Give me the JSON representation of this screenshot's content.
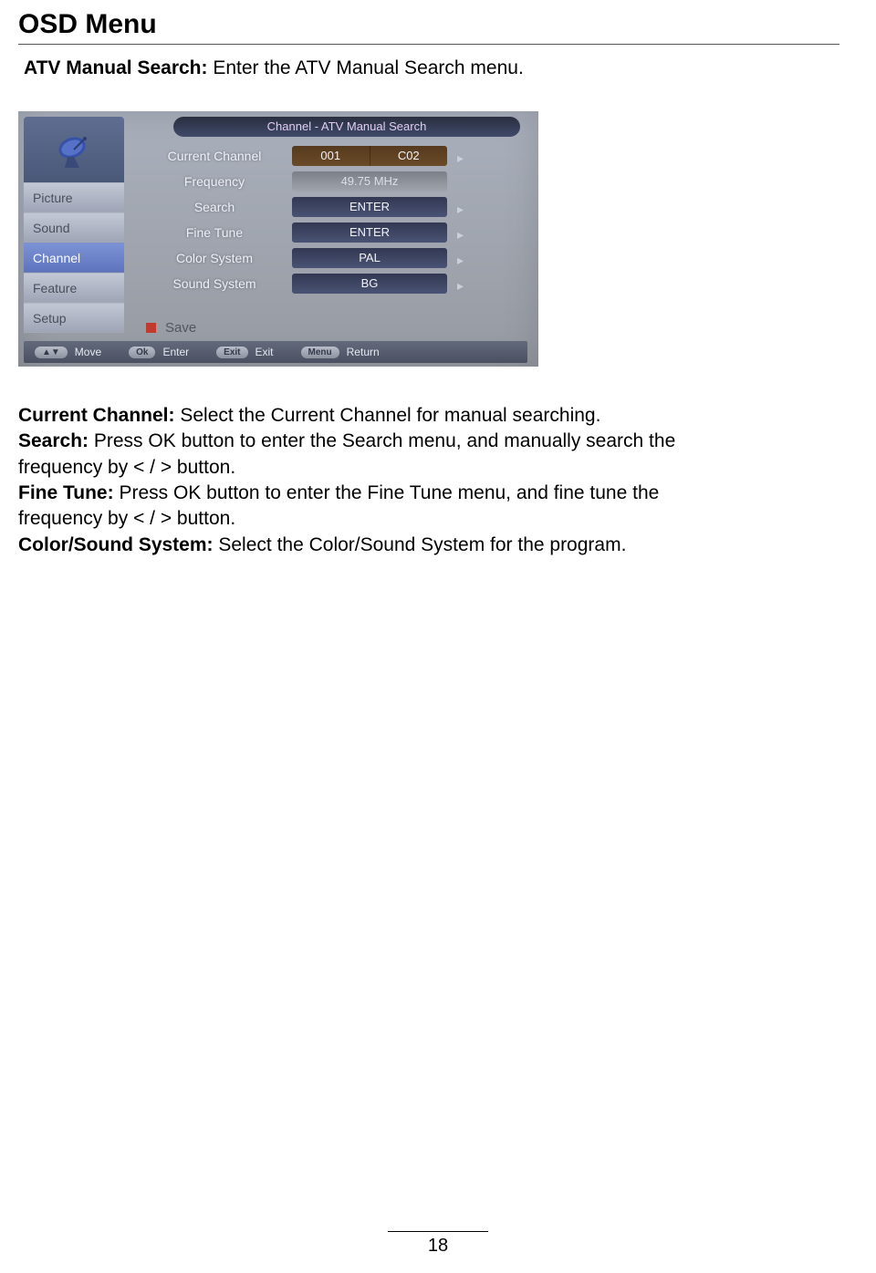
{
  "page_title": "OSD Menu",
  "intro": {
    "bold": "ATV Manual Search:",
    "text": " Enter the ATV Manual Search menu."
  },
  "osd": {
    "title": "Channel - ATV Manual Search",
    "sidebar": {
      "items": [
        {
          "label": "Picture",
          "active": false
        },
        {
          "label": "Sound",
          "active": false
        },
        {
          "label": "Channel",
          "active": true
        },
        {
          "label": "Feature",
          "active": false
        },
        {
          "label": "Setup",
          "active": false
        }
      ]
    },
    "rows": [
      {
        "label": "Current Channel",
        "style": "split",
        "value_l": "001",
        "value_r": "C02",
        "chevron": true
      },
      {
        "label": "Frequency",
        "style": "grey",
        "value": "49.75 MHz",
        "chevron": false
      },
      {
        "label": "Search",
        "style": "dark",
        "value": "ENTER",
        "chevron": true
      },
      {
        "label": "Fine Tune",
        "style": "dark",
        "value": "ENTER",
        "chevron": true
      },
      {
        "label": "Color System",
        "style": "dark",
        "value": "PAL",
        "chevron": true
      },
      {
        "label": "Sound System",
        "style": "dark",
        "value": "BG",
        "chevron": true
      }
    ],
    "save_label": "Save",
    "footer": [
      {
        "badge": "▲▼",
        "label": "Move"
      },
      {
        "badge": "Ok",
        "label": "Enter"
      },
      {
        "badge": "Exit",
        "label": "Exit"
      },
      {
        "badge": "Menu",
        "label": "Return"
      }
    ]
  },
  "descriptions": [
    {
      "bold": "Current Channel:",
      "text": " Select the Current Channel for manual searching."
    },
    {
      "bold": "Search:",
      "text": " Press OK button to enter the Search menu, and manually search the frequency by < / > button."
    },
    {
      "bold": "Fine Tune:",
      "text": " Press OK button to enter the Fine Tune menu, and fine tune the frequency by < / > button."
    },
    {
      "bold": "Color/Sound System:",
      "text": " Select the Color/Sound System for the program."
    }
  ],
  "page_number": "18"
}
